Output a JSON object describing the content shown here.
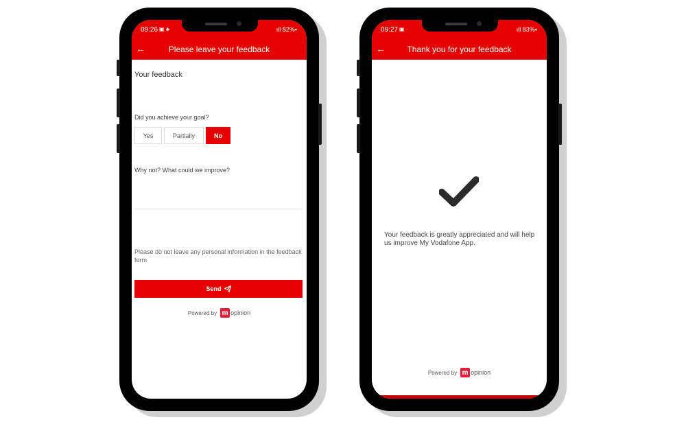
{
  "left": {
    "status": {
      "time": "09:26",
      "icons": "▣ ♣",
      "battery": "ıll 82%▪"
    },
    "appbar": {
      "back_icon": "←",
      "title": "Please leave your feedback"
    },
    "heading": "Your feedback",
    "question1": "Did you achieve your goal?",
    "choices": [
      {
        "label": "Yes",
        "selected": false
      },
      {
        "label": "Partially",
        "selected": false
      },
      {
        "label": "No",
        "selected": true
      }
    ],
    "question2": "Why not? What could we improve?",
    "improve_value": "",
    "notice": "Please do not leave any personal information in the feedback form",
    "send_label": "Send",
    "send_icon": "paper-plane-icon",
    "powered_by": "Powered by",
    "logo_letter": "m",
    "logo_text": "opinion"
  },
  "right": {
    "status": {
      "time": "09:27",
      "icons": "▣ ·",
      "battery": "ıll 83%▪"
    },
    "appbar": {
      "back_icon": "←",
      "title": "Thank you for your feedback"
    },
    "message": "Your feedback is greatly appreciated and will help us improve My Vodafone App.",
    "powered_by": "Powered by",
    "logo_letter": "m",
    "logo_text": "opinion"
  },
  "colors": {
    "brand_red": "#e60000",
    "logo_red": "#e0203b",
    "check_dark": "#2b2b2b"
  }
}
